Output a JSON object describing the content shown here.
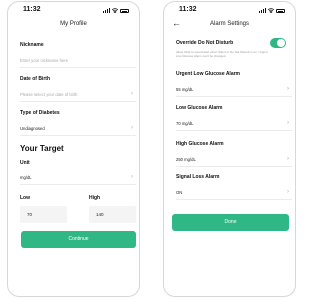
{
  "status": {
    "time": "11:32"
  },
  "profile": {
    "title": "My Profile",
    "nickname_label": "Nickname",
    "nickname_placeholder": "Enter your nickname here",
    "dob_label": "Date of Birth",
    "dob_placeholder": "Please select your date of birth",
    "diabetes_label": "Type of Diabetes",
    "diabetes_value": "Undiagnosed",
    "target_title": "Your Target",
    "unit_label": "Unit",
    "unit_value": "mg/dL",
    "low_label": "Low",
    "low_value": "70",
    "high_label": "High",
    "high_value": "140",
    "continue_label": "Continue"
  },
  "alarm": {
    "title": "Alarm Settings",
    "dnd_label": "Override Do Not Disturb",
    "dnd_description": "Allow Ottai to sound alert when Silent or Do Not Disturb is on. Urgent Low Glucose Alarm can't be changed.",
    "dnd_enabled": true,
    "urgent_low_label": "Urgent Low Glucose Alarm",
    "urgent_low_value": "55 mg/dL",
    "low_label": "Low Glucose Alarm",
    "low_value": "70 mg/dL",
    "high_label": "High Glucose Alarm",
    "high_value": "250 mg/dL",
    "signal_label": "Signal Loss Alarm",
    "signal_value": "ON",
    "done_label": "Done"
  },
  "colors": {
    "accent": "#2fb885"
  },
  "icons": {
    "back": "back-arrow-icon",
    "chevron": "chevron-right-icon"
  }
}
